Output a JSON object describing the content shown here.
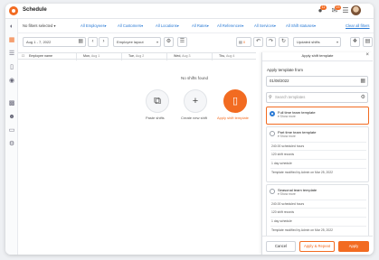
{
  "app": {
    "title": "Schedule"
  },
  "topbar": {
    "badges": [
      "11",
      "23"
    ],
    "icons": [
      "bell-icon",
      "chat-icon",
      "menu-icon",
      "avatar"
    ]
  },
  "filters": {
    "none_selected": "No filters selected",
    "items": [
      "All Employees",
      "All Customers",
      "All Locations",
      "All Rates",
      "All References",
      "All Services",
      "All Shift statuses"
    ],
    "clear": "Clear all filters"
  },
  "toolbar": {
    "date_range": "Aug 1 - 7, 2022",
    "layout": "Employee layout",
    "count": "0",
    "status": "Updated shifts"
  },
  "grid": {
    "columns": [
      {
        "label": "Employee name",
        "sub": ""
      },
      {
        "label": "Mon,",
        "sub": "Aug 1"
      },
      {
        "label": "Tue,",
        "sub": "Aug 2"
      },
      {
        "label": "Wed,",
        "sub": "Aug 3"
      },
      {
        "label": "Thu,",
        "sub": "Aug 4"
      }
    ],
    "empty_text": "No shifts found",
    "actions": [
      {
        "label": "Paste shifts",
        "icon": "copy-icon"
      },
      {
        "label": "Create new shift",
        "icon": "plus-icon"
      },
      {
        "label": "Apply shift template",
        "icon": "clipboard-icon"
      }
    ]
  },
  "panel": {
    "title": "Apply shift template",
    "from_label": "Apply template from",
    "date": "01/08/2022",
    "search_placeholder": "Search templates",
    "templates": [
      {
        "name": "Full time team template",
        "show_more": "Show more",
        "selected": true,
        "stats": []
      },
      {
        "name": "Part time team template",
        "show_more": "Show more",
        "selected": false,
        "stats": [
          "240.00 scheduled hours",
          "120 shift records",
          "1 day schedule",
          "Template modified by Admin on Mar 25, 2022"
        ]
      },
      {
        "name": "Seasonal team template",
        "show_more": "Show more",
        "selected": false,
        "stats": [
          "240.00 scheduled hours",
          "120 shift records",
          "1 day schedule",
          "Template modified by Admin on Mar 25, 2022"
        ]
      }
    ],
    "buttons": {
      "cancel": "Cancel",
      "apply_repeat": "Apply & Repeat",
      "apply": "Apply"
    }
  },
  "colors": {
    "accent": "#f26b21",
    "link": "#2a7ad5"
  }
}
